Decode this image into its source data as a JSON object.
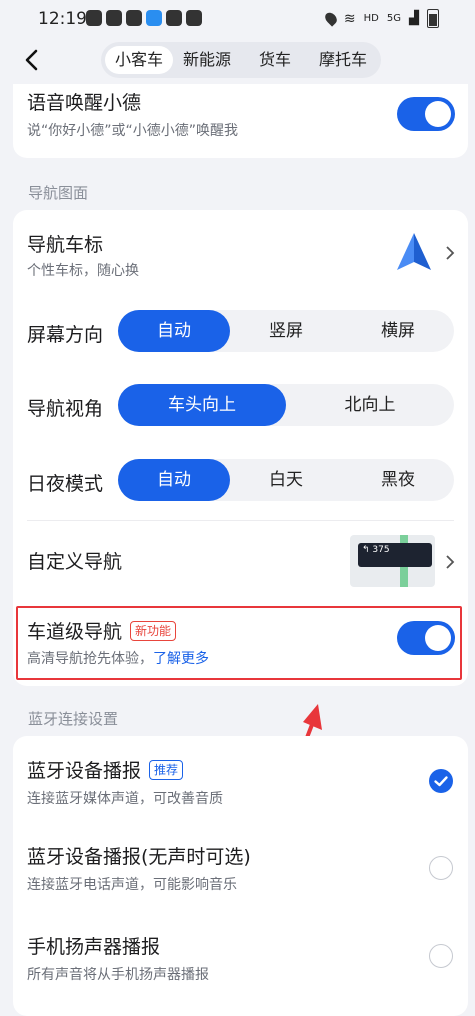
{
  "status_bar": {
    "time": "12:19",
    "network": "HD",
    "signal": "5G"
  },
  "tabs": {
    "items": [
      "小客车",
      "新能源",
      "货车",
      "摩托车"
    ]
  },
  "voice": {
    "title": "语音唤醒小德",
    "subtitle": "说“你好小德”或“小德小德”唤醒我"
  },
  "nav_section": {
    "title": "导航图面"
  },
  "car_icon": {
    "title": "导航车标",
    "subtitle": "个性车标，随心换"
  },
  "orientation": {
    "label": "屏幕方向",
    "options": [
      "自动",
      "竖屏",
      "横屏"
    ],
    "selected": "自动"
  },
  "view_angle": {
    "label": "导航视角",
    "options": [
      "车头向上",
      "北向上"
    ],
    "selected": "车头向上"
  },
  "day_night": {
    "label": "日夜模式",
    "options": [
      "自动",
      "白天",
      "黑夜"
    ],
    "selected": "自动"
  },
  "custom_nav": {
    "title": "自定义导航",
    "preview_text": "375"
  },
  "lane_nav": {
    "title": "车道级导航",
    "badge": "新功能",
    "subtitle": "高清导航抢先体验，",
    "link": "了解更多",
    "enabled": true
  },
  "bt_section": {
    "title": "蓝牙连接设置"
  },
  "bt_options": [
    {
      "title": "蓝牙设备播报",
      "badge": "推荐",
      "subtitle": "连接蓝牙媒体声道，可改善音质",
      "checked": true
    },
    {
      "title": "蓝牙设备播报(无声时可选)",
      "subtitle": "连接蓝牙电话声道，可能影响音乐",
      "checked": false
    },
    {
      "title": "手机扬声器播报",
      "subtitle": "所有声音将从手机扬声器播报",
      "checked": false
    }
  ],
  "colors": {
    "accent": "#1a62e8",
    "annotation": "#e8363b",
    "background": "#f2f3f7"
  }
}
